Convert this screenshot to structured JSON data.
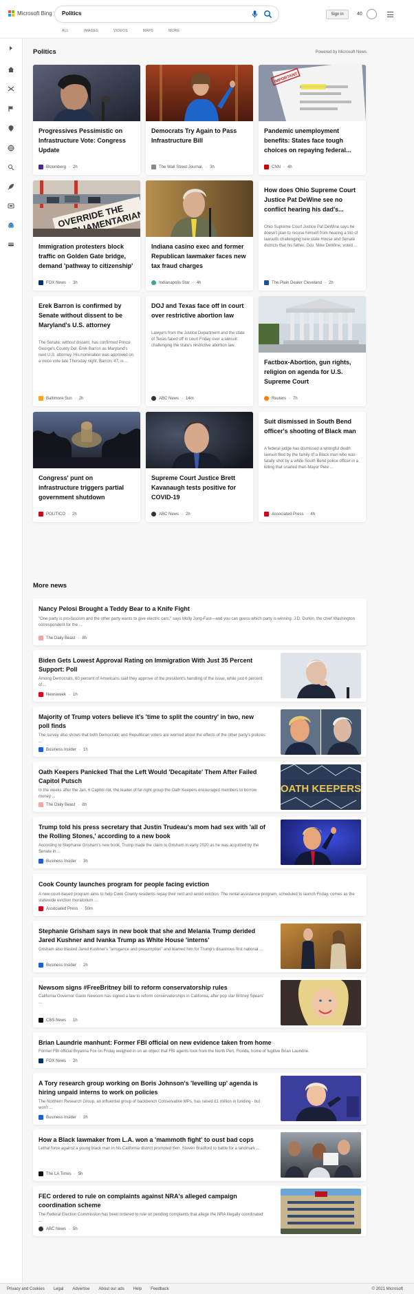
{
  "brand": {
    "name": "Microsoft Bing",
    "colors": [
      "#f35325",
      "#81bc06",
      "#05a6f0",
      "#ffba08"
    ]
  },
  "search": {
    "query": "Politics"
  },
  "subnav": [
    "ALL",
    "IMAGES",
    "VIDEOS",
    "MAPS",
    "MORE"
  ],
  "header": {
    "signin_label": "Sign in",
    "points": "40"
  },
  "sidebar_icons": [
    "expand-icon",
    "home-icon",
    "shuffle-icon",
    "flag-icon",
    "location-icon",
    "globe-icon",
    "science-icon",
    "rocket-icon",
    "tv-icon",
    "bank-icon",
    "card-icon"
  ],
  "section": {
    "title": "Politics",
    "powered_by": "Powered by Microsoft News"
  },
  "cards": [
    {
      "title": "Progressives Pessimistic on Infrastructure Vote: Congress Update",
      "desc": "",
      "source": "Bloomberg",
      "age": "2h",
      "fav": "#472a91"
    },
    {
      "title": "Democrats Try Again to Pass Infrastructure Bill",
      "desc": "",
      "source": "The Wall Street Journal.",
      "age": "3h",
      "fav": "#888888"
    },
    {
      "title": "Pandemic unemployment benefits: States face tough choices on repaying federal...",
      "desc": "",
      "source": "CNN",
      "age": "4h",
      "fav": "#cc0000"
    },
    {
      "title": "Immigration protesters block traffic on Golden Gate bridge, demand 'pathway to citizenship'",
      "desc": "",
      "source": "FOX News",
      "age": "3h",
      "fav": "#003366"
    },
    {
      "title": "Indiana casino exec and former Republican lawmaker faces new tax fraud charges",
      "desc": "",
      "source": "Indianapolis Star",
      "age": "4h",
      "fav": "#3aa3a3"
    },
    {
      "title": "How does Ohio Supreme Court Justice Pat DeWine see no conflict hearing his dad's...",
      "desc": "Ohio Supreme Court Justice Pat DeWine says he doesn't plan to recuse himself from hearing a trio of lawsuits challenging new state House and Senate districts that his father, Gov. Mike DeWine, voted ...",
      "source": "The Plain Dealer Cleveland",
      "age": "2h",
      "fav": "#1d4f91"
    },
    {
      "title": "Erek Barron is confirmed by Senate without dissent to be Maryland's U.S. attorney",
      "desc": "The Senate, without dissent, has confirmed Prince George's County Del. Erek Barron as Maryland's next U.S. attorney. His nomination was approved on a voice vote late Thursday night. Barron, 47, is ...",
      "source": "Baltimore Sun",
      "age": "2h",
      "fav": "#f5a623"
    },
    {
      "title": "DOJ and Texas face off in court over restrictive abortion law",
      "desc": "Lawyers from the Justice Department and the state of Texas faced off in court Friday over a lawsuit challenging the state's restrictive abortion law.",
      "source": "ABC News",
      "age": "14m",
      "fav": "#333333"
    },
    {
      "title": "Factbox-Abortion, gun rights, religion on agenda for U.S. Supreme Court",
      "desc": "",
      "source": "Reuters",
      "age": "7h",
      "fav": "#ff8000"
    },
    {
      "title": "Congress' punt on infrastructure triggers partial government shutdown",
      "desc": "",
      "source": "POLITICO",
      "age": "2h",
      "fav": "#d0021b"
    },
    {
      "title": "Supreme Court Justice Brett Kavanaugh tests positive for COVID-19",
      "desc": "",
      "source": "ABC News",
      "age": "2h",
      "fav": "#333333"
    },
    {
      "title": "Suit dismissed in South Bend officer's shooting of Black man",
      "desc": "A federal judge has dismissed a wrongful death lawsuit filed by the family of a Black man who was fatally shot by a white South Bend police officer in a killing that snarled then-Mayor Pete ...",
      "source": "Associated Press",
      "age": "4h",
      "fav": "#d0021b"
    }
  ],
  "more_news": {
    "title": "More news",
    "items": [
      {
        "title": "Nancy Pelosi Brought a Teddy Bear to a Knife Fight",
        "desc": "\"One party is pro-fascism and the other party wants to give electric cars,\" says Molly Jong-Fast—and you can guess which party is winning. J.D. Durkin, the chief Washington correspondent for the ...",
        "source": "The Daily Beast",
        "age": "8h",
        "fav": "#f4a6a6"
      },
      {
        "title": "Biden Gets Lowest Approval Rating on Immigration With Just 35 Percent Support: Poll",
        "desc": "Among Democrats, 60 percent of Americans said they approve of the president's handling of the issue, while just 6 percent of ...",
        "source": "Newsweek",
        "age": "1h",
        "fav": "#e2001a"
      },
      {
        "title": "Majority of Trump voters believe it's 'time to split the country' in two, new poll finds",
        "desc": "The survey also shows that both Democratic and Republican voters are worried about the effects of the other party's policies ...",
        "source": "Business Insider",
        "age": "1h",
        "fav": "#1c5fd6"
      },
      {
        "title": "Oath Keepers Panicked That the Left Would 'Decapitate' Them After Failed Capitol Putsch",
        "desc": "In the weeks after the Jan. 6 Capitol riot, the leader of far-right group the Oath Keepers encouraged members to borrow money ...",
        "source": "The Daily Beast",
        "age": "8h",
        "fav": "#f4a6a6"
      },
      {
        "title": "Trump told his press secretary that Justin Trudeau's mom had sex with 'all of the Rolling Stones,' according to a new book",
        "desc": "According to Stephanie Grisham's new book, Trump made the claim to Grisham in early 2020 as he was acquitted by the Senate in ...",
        "source": "Business Insider",
        "age": "3h",
        "fav": "#1c5fd6"
      },
      {
        "title": "Cook County launches program for people facing eviction",
        "desc": "A new court-based program aims to help Cook County residents repay their rent and avoid eviction. The rental assistance program, scheduled to launch Friday, comes as the statewide eviction moratorium ...",
        "source": "Associated Press",
        "age": "50m",
        "fav": "#d0021b"
      },
      {
        "title": "Stephanie Grisham says in new book that she and Melania Trump derided Jared Kushner and Ivanka Trump as White House 'interns'",
        "desc": "Grisham also blasted Jared Kushner's \"arrogance and presumption\" and blamed him for Trump's disastrous first national ...",
        "source": "Business Insider",
        "age": "2h",
        "fav": "#1c5fd6"
      },
      {
        "title": "Newsom signs #FreeBritney bill to reform conservatorship rules",
        "desc": "California Governor Gavin Newsom has signed a law to reform conservatorships in California, after pop star Britney Spears' ...",
        "source": "CBS News",
        "age": "1h",
        "fav": "#111111"
      },
      {
        "title": "Brian Laundrie manhunt: Former FBI official on new evidence taken from home",
        "desc": "Former FBI official Bryanna Fox on Friday weighed in on an object that FBI agents took from the North Port, Florida, home of fugitive Brian Laundrie.",
        "source": "FOX News",
        "age": "2h",
        "fav": "#003366"
      },
      {
        "title": "A Tory research group working on Boris Johnson's 'levelling up' agenda is hiring unpaid interns to work on policies",
        "desc": "The Northern Research Group, an influential group of backbench Conservative MPs, has raised £1 million in funding - but won't ...",
        "source": "Business Insider",
        "age": "2h",
        "fav": "#1c5fd6"
      },
      {
        "title": "How a Black lawmaker from L.A. won a 'mammoth fight' to oust bad cops",
        "desc": "Lethal force against a young black man in his California district prompted Sen. Steven Bradford to battle for a landmark ...",
        "source": "The LA Times",
        "age": "5h",
        "fav": "#111111"
      },
      {
        "title": "FEC ordered to rule on complaints against NRA's alleged campaign coordination scheme",
        "desc": "The Federal Election Commission has been ordered to rule on pending complaints that allege the NRA illegally coordinated ...",
        "source": "ABC News",
        "age": "5h",
        "fav": "#333333"
      }
    ]
  },
  "image_texts": {
    "override_sign": "OVERRIDE THE PARLIAMENTARIAN",
    "oath_keepers": "OATH KEEPERS",
    "stamp": "IMPORTANT"
  },
  "footer": {
    "links": [
      "Privacy and Cookies",
      "Legal",
      "Advertise",
      "About our ads",
      "Help",
      "Feedback"
    ],
    "copyright": "© 2021 Microsoft"
  }
}
